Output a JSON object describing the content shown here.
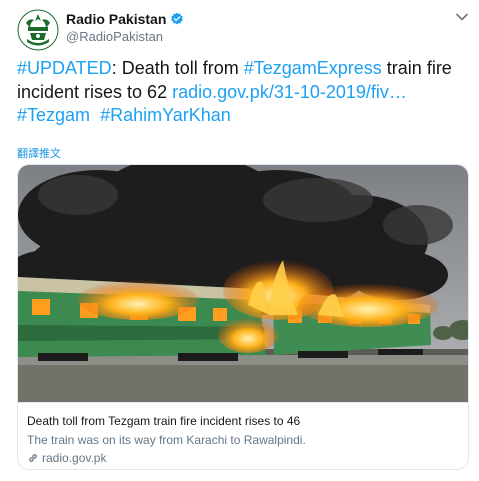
{
  "account": {
    "display_name": "Radio Pakistan",
    "handle": "@RadioPakistan"
  },
  "tweet": {
    "tag_updated": "#UPDATED",
    "text_1": ": Death toll from ",
    "tag_express": "#TezgamExpress",
    "text_2": " train fire incident rises to 62 ",
    "link": "radio.gov.pk/31-10-2019/fiv…",
    "tag_tezgam": "#Tezgam",
    "tag_rahim": "#RahimYarKhan"
  },
  "translate_label": "翻譯推文",
  "card": {
    "title": "Death toll from Tezgam train fire incident rises to 46",
    "description": "The train was on its way from Karachi to Rawalpindi.",
    "domain": "radio.gov.pk"
  },
  "colors": {
    "link": "#1da1f2",
    "verified": "#1da1f2",
    "avatar_green": "#1f6b2e"
  },
  "icons": [
    "radio-pakistan-logo",
    "verified-badge-icon",
    "chevron-down-icon",
    "link-icon"
  ]
}
